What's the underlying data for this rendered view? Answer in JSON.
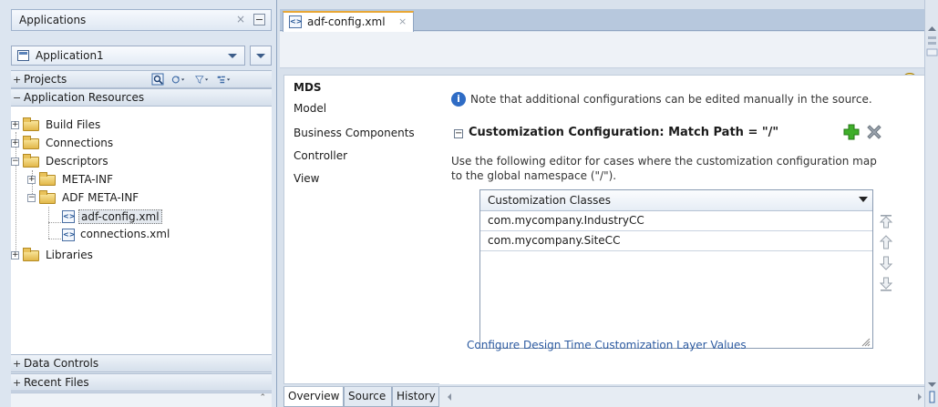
{
  "navigator": {
    "title": "Applications",
    "application": "Application1",
    "projects_label": "Projects",
    "app_resources_label": "Application Resources",
    "data_controls_label": "Data Controls",
    "recent_files_label": "Recent Files",
    "tree": {
      "build_files": "Build Files",
      "connections": "Connections",
      "descriptors": "Descriptors",
      "meta_inf": "META-INF",
      "adf_meta_inf": "ADF META-INF",
      "adf_config": "adf-config.xml",
      "connections_xml": "connections.xml",
      "libraries": "Libraries"
    }
  },
  "editor": {
    "tab_label": "adf-config.xml",
    "sidebar": [
      "MDS",
      "Model",
      "Business Components",
      "Controller",
      "View"
    ],
    "note": "Note that additional configurations can be edited manually in the source.",
    "section_title": "Customization Configuration: Match Path = \"/\"",
    "description": "Use the following editor for cases where the customization configuration map to the global namespace (\"/\").",
    "table_header": "Customization Classes",
    "rows": [
      "com.mycompany.IndustryCC",
      "com.mycompany.SiteCC"
    ],
    "link": "Configure Design Time Customization Layer Values",
    "bottom_tabs": [
      "Overview",
      "Source",
      "History"
    ]
  },
  "icons": {
    "add": "add-icon",
    "remove": "remove-icon",
    "help": "help-icon",
    "info": "info-icon"
  },
  "colors": {
    "accent_tab": "#e8a736",
    "link": "#2c5aa0",
    "add_green": "#3fae2a"
  }
}
